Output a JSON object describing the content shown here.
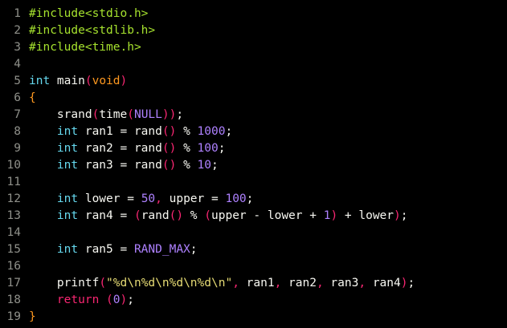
{
  "colors": {
    "background": "#000000",
    "line_number": "#8f908a",
    "default": "#f8f8f2",
    "preprocessor": "#a6e22e",
    "include_path": "#a6e22e",
    "type_keyword": "#66d9ef",
    "function": "#f8f8f2",
    "paren": "#f92672",
    "brace": "#fd971f",
    "number": "#ae81ff",
    "string": "#e6db74",
    "constant": "#ae81ff",
    "punct": "#f92672",
    "keyword": "#f92672",
    "operator": "#f8f8f2"
  },
  "editor": {
    "lines": [
      {
        "n": "1",
        "tokens": [
          {
            "t": "#include",
            "c": "preprocessor"
          },
          {
            "t": "<stdio.h>",
            "c": "include_path"
          }
        ]
      },
      {
        "n": "2",
        "tokens": [
          {
            "t": "#include",
            "c": "preprocessor"
          },
          {
            "t": "<stdlib.h>",
            "c": "include_path"
          }
        ]
      },
      {
        "n": "3",
        "tokens": [
          {
            "t": "#include",
            "c": "preprocessor"
          },
          {
            "t": "<time.h>",
            "c": "include_path"
          }
        ]
      },
      {
        "n": "4",
        "tokens": []
      },
      {
        "n": "5",
        "tokens": [
          {
            "t": "int",
            "c": "type_keyword"
          },
          {
            "t": " main",
            "c": "default"
          },
          {
            "t": "(",
            "c": "paren"
          },
          {
            "t": "void",
            "c": "brace"
          },
          {
            "t": ")",
            "c": "paren"
          }
        ]
      },
      {
        "n": "6",
        "tokens": [
          {
            "t": "{",
            "c": "brace"
          }
        ]
      },
      {
        "n": "7",
        "tokens": [
          {
            "t": "    srand",
            "c": "default"
          },
          {
            "t": "(",
            "c": "paren"
          },
          {
            "t": "time",
            "c": "default"
          },
          {
            "t": "(",
            "c": "paren"
          },
          {
            "t": "NULL",
            "c": "constant"
          },
          {
            "t": "))",
            "c": "paren"
          },
          {
            "t": ";",
            "c": "default"
          }
        ]
      },
      {
        "n": "8",
        "tokens": [
          {
            "t": "    int",
            "c": "type_keyword"
          },
          {
            "t": " ran1 = rand",
            "c": "default"
          },
          {
            "t": "()",
            "c": "paren"
          },
          {
            "t": " % ",
            "c": "default"
          },
          {
            "t": "1000",
            "c": "number"
          },
          {
            "t": ";",
            "c": "default"
          }
        ]
      },
      {
        "n": "9",
        "tokens": [
          {
            "t": "    int",
            "c": "type_keyword"
          },
          {
            "t": " ran2 = rand",
            "c": "default"
          },
          {
            "t": "()",
            "c": "paren"
          },
          {
            "t": " % ",
            "c": "default"
          },
          {
            "t": "100",
            "c": "number"
          },
          {
            "t": ";",
            "c": "default"
          }
        ]
      },
      {
        "n": "10",
        "tokens": [
          {
            "t": "    int",
            "c": "type_keyword"
          },
          {
            "t": " ran3 = rand",
            "c": "default"
          },
          {
            "t": "()",
            "c": "paren"
          },
          {
            "t": " % ",
            "c": "default"
          },
          {
            "t": "10",
            "c": "number"
          },
          {
            "t": ";",
            "c": "default"
          }
        ]
      },
      {
        "n": "11",
        "tokens": []
      },
      {
        "n": "12",
        "tokens": [
          {
            "t": "    int",
            "c": "type_keyword"
          },
          {
            "t": " lower = ",
            "c": "default"
          },
          {
            "t": "50",
            "c": "number"
          },
          {
            "t": ",",
            "c": "punct"
          },
          {
            "t": " upper = ",
            "c": "default"
          },
          {
            "t": "100",
            "c": "number"
          },
          {
            "t": ";",
            "c": "default"
          }
        ]
      },
      {
        "n": "13",
        "tokens": [
          {
            "t": "    int",
            "c": "type_keyword"
          },
          {
            "t": " ran4 = ",
            "c": "default"
          },
          {
            "t": "(",
            "c": "paren"
          },
          {
            "t": "rand",
            "c": "default"
          },
          {
            "t": "()",
            "c": "paren"
          },
          {
            "t": " % ",
            "c": "default"
          },
          {
            "t": "(",
            "c": "paren"
          },
          {
            "t": "upper - lower + ",
            "c": "default"
          },
          {
            "t": "1",
            "c": "number"
          },
          {
            "t": ")",
            "c": "paren"
          },
          {
            "t": " + lower",
            "c": "default"
          },
          {
            "t": ")",
            "c": "paren"
          },
          {
            "t": ";",
            "c": "default"
          }
        ]
      },
      {
        "n": "14",
        "tokens": []
      },
      {
        "n": "15",
        "tokens": [
          {
            "t": "    int",
            "c": "type_keyword"
          },
          {
            "t": " ran5 = ",
            "c": "default"
          },
          {
            "t": "RAND_MAX",
            "c": "constant"
          },
          {
            "t": ";",
            "c": "default"
          }
        ]
      },
      {
        "n": "16",
        "tokens": []
      },
      {
        "n": "17",
        "tokens": [
          {
            "t": "    printf",
            "c": "default"
          },
          {
            "t": "(",
            "c": "paren"
          },
          {
            "t": "\"%d\\n%d\\n%d\\n%d\\n\"",
            "c": "string"
          },
          {
            "t": ",",
            "c": "punct"
          },
          {
            "t": " ran1",
            "c": "default"
          },
          {
            "t": ",",
            "c": "punct"
          },
          {
            "t": " ran2",
            "c": "default"
          },
          {
            "t": ",",
            "c": "punct"
          },
          {
            "t": " ran3",
            "c": "default"
          },
          {
            "t": ",",
            "c": "punct"
          },
          {
            "t": " ran4",
            "c": "default"
          },
          {
            "t": ")",
            "c": "paren"
          },
          {
            "t": ";",
            "c": "default"
          }
        ]
      },
      {
        "n": "18",
        "tokens": [
          {
            "t": "    return",
            "c": "keyword"
          },
          {
            "t": " ",
            "c": "default"
          },
          {
            "t": "(",
            "c": "paren"
          },
          {
            "t": "0",
            "c": "number"
          },
          {
            "t": ")",
            "c": "paren"
          },
          {
            "t": ";",
            "c": "default"
          }
        ]
      },
      {
        "n": "19",
        "tokens": [
          {
            "t": "}",
            "c": "brace"
          }
        ]
      }
    ]
  }
}
